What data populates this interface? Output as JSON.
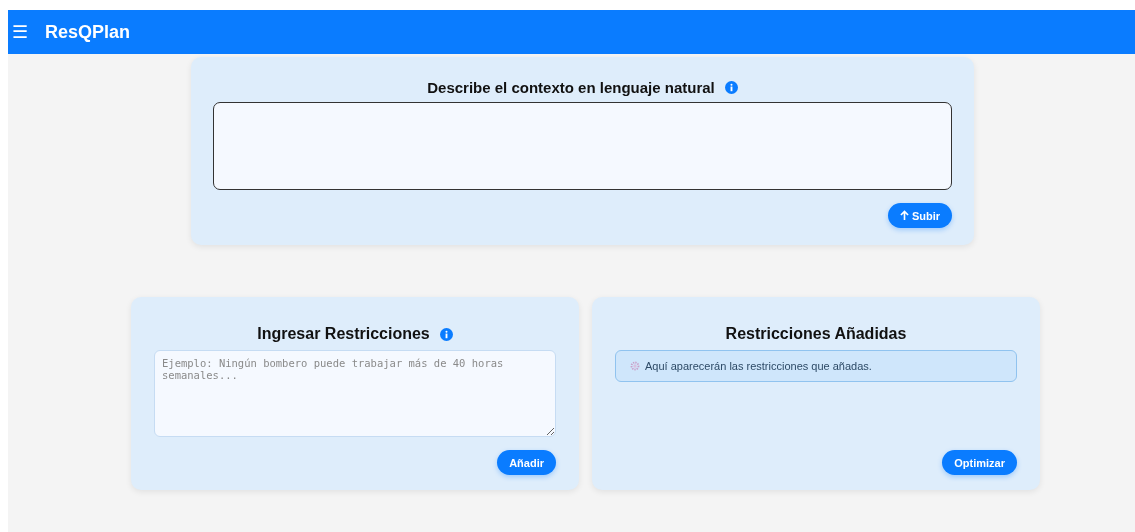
{
  "header": {
    "menu_icon": "☰",
    "title": "ResQPlan"
  },
  "context": {
    "title": "Describe el contexto en lenguaje natural",
    "upload_button": "Subir"
  },
  "constraints_input": {
    "title": "Ingresar Restricciones",
    "placeholder": "Ejemplo: Ningún bombero puede trabajar más de 40 horas semanales...",
    "add_button": "Añadir"
  },
  "added_constraints": {
    "title": "Restricciones Añadidas",
    "empty_message": "Aquí aparecerán las restricciones que añadas.",
    "optimize_button": "Optimizar"
  }
}
